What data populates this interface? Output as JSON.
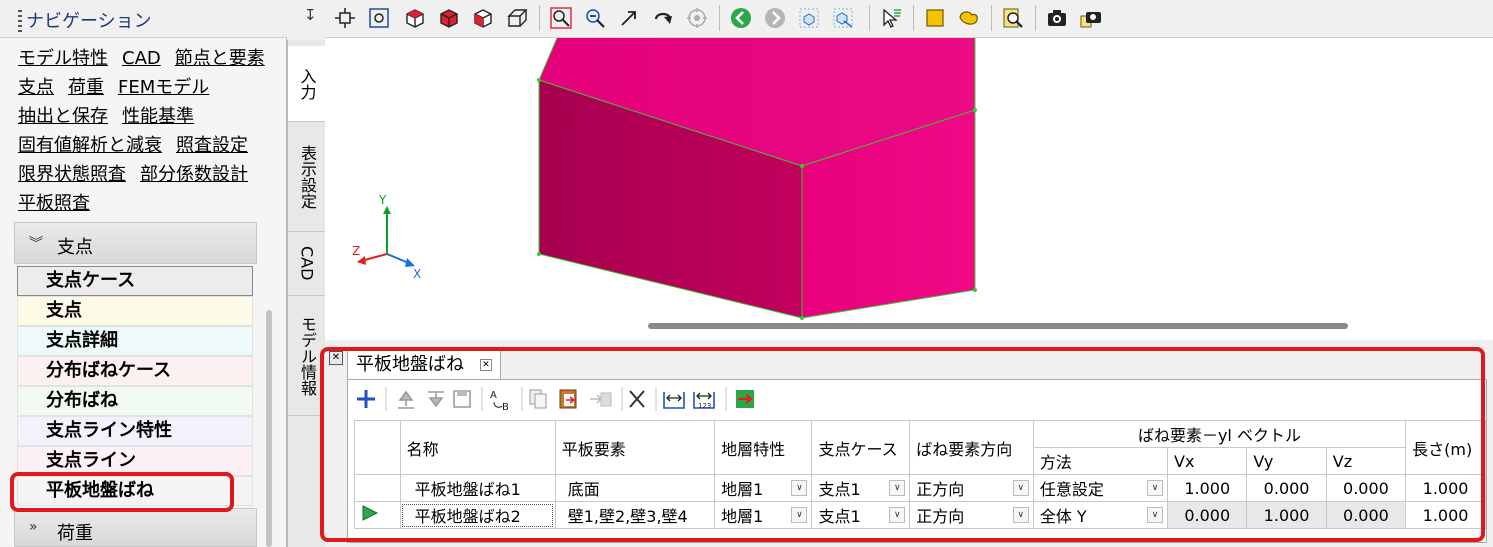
{
  "nav": {
    "title": "ナビゲーション",
    "links": [
      [
        "モデル特性",
        "CAD",
        "節点と要素"
      ],
      [
        "支点",
        "荷重",
        "FEMモデル"
      ],
      [
        "抽出と保存",
        "性能基準"
      ],
      [
        "固有値解析と減衰",
        "照査設定"
      ],
      [
        "限界状態照査",
        "部分係数設計"
      ],
      [
        "平板照査"
      ]
    ],
    "section_support": "支点",
    "support_items": [
      {
        "label": "支点ケース",
        "color": "#ececec"
      },
      {
        "label": "支点",
        "color": "#fdfbe8"
      },
      {
        "label": "支点詳細",
        "color": "#eefaf9"
      },
      {
        "label": "分布ばねケース",
        "color": "#fdf0f0"
      },
      {
        "label": "分布ばね",
        "color": "#f1faf0"
      },
      {
        "label": "支点ライン特性",
        "color": "#f3f1fc"
      },
      {
        "label": "支点ライン",
        "color": "#fdf1f6"
      },
      {
        "label": "平板地盤ばね",
        "color": "#f5f5f5"
      }
    ],
    "section_load": "荷重"
  },
  "vtabs": [
    "入力",
    "表示設定",
    "CAD",
    "モデル情報"
  ],
  "axes": {
    "x": "X",
    "y": "Y",
    "z": "Z"
  },
  "panel": {
    "tab_title": "平板地盤ばね",
    "columns": {
      "name": "名称",
      "plate": "平板要素",
      "layer": "地層特性",
      "support_case": "支点ケース",
      "direction": "ばね要素方向",
      "vector_group": "ばね要素－yl ベクトル",
      "method": "方法",
      "vx": "Vx",
      "vy": "Vy",
      "vz": "Vz",
      "length": "長さ(m)"
    },
    "rows": [
      {
        "name": "平板地盤ばね1",
        "plate": "底面",
        "layer": "地層1",
        "support_case": "支点1",
        "direction": "正方向",
        "method": "任意設定",
        "vx": "1.000",
        "vy": "0.000",
        "vz": "0.000",
        "length": "1.000"
      },
      {
        "name": "平板地盤ばね2",
        "plate": "壁1,壁2,壁3,壁4",
        "layer": "地層1",
        "support_case": "支点1",
        "direction": "正方向",
        "method": "全体 Y",
        "vx": "0.000",
        "vy": "1.000",
        "vz": "0.000",
        "length": "1.000"
      }
    ]
  },
  "colors": {
    "box_face": "#e6007a",
    "highlight": "#e0191b",
    "axis_x": "#1a6fe0",
    "axis_y": "#10a020",
    "axis_z": "#e02020"
  }
}
